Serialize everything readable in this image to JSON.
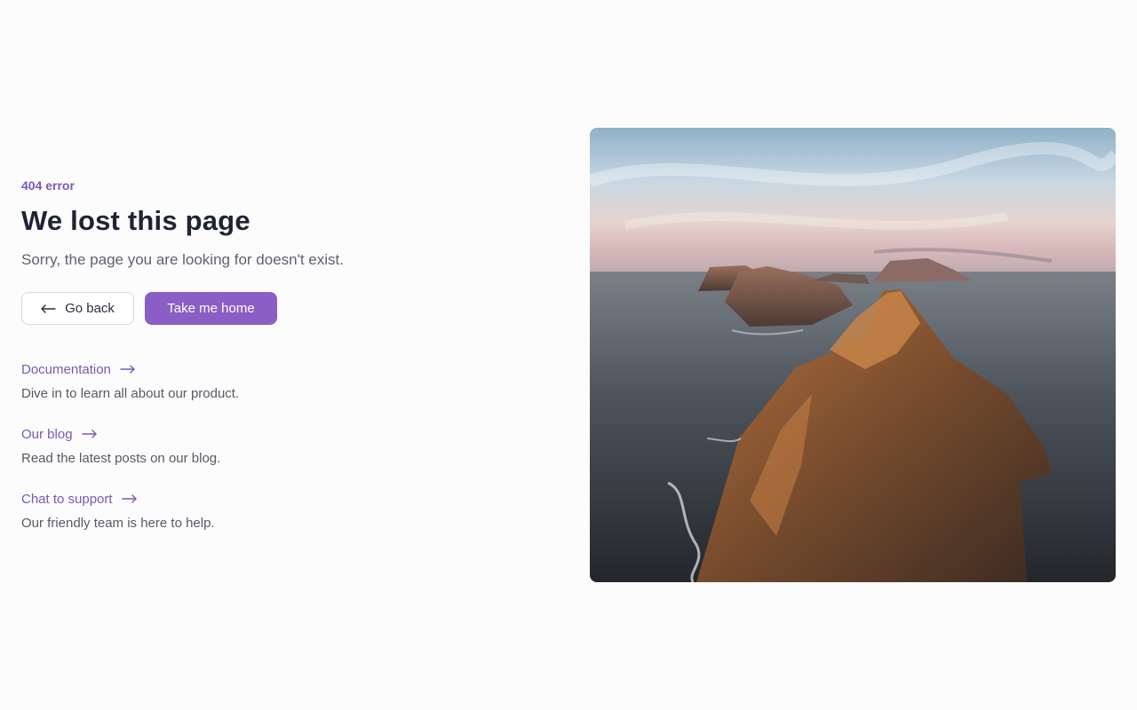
{
  "error": {
    "eyebrow": "404 error",
    "title": "We lost this page",
    "subtitle": "Sorry, the page you are looking for doesn't exist."
  },
  "actions": {
    "back_label": "Go back",
    "home_label": "Take me home"
  },
  "links": [
    {
      "label": "Documentation",
      "description": "Dive in to learn all about our product."
    },
    {
      "label": "Our blog",
      "description": "Read the latest posts on our blog."
    },
    {
      "label": "Chat to support",
      "description": "Our friendly team is here to help."
    }
  ],
  "icons": {
    "back": "arrow-left-icon",
    "link": "arrow-right-icon"
  },
  "colors": {
    "accent": "#8a5ec4",
    "accent_text": "#7c58b3",
    "heading": "#1f2433",
    "body_text": "#5f6270",
    "background": "#fcfcfc"
  }
}
